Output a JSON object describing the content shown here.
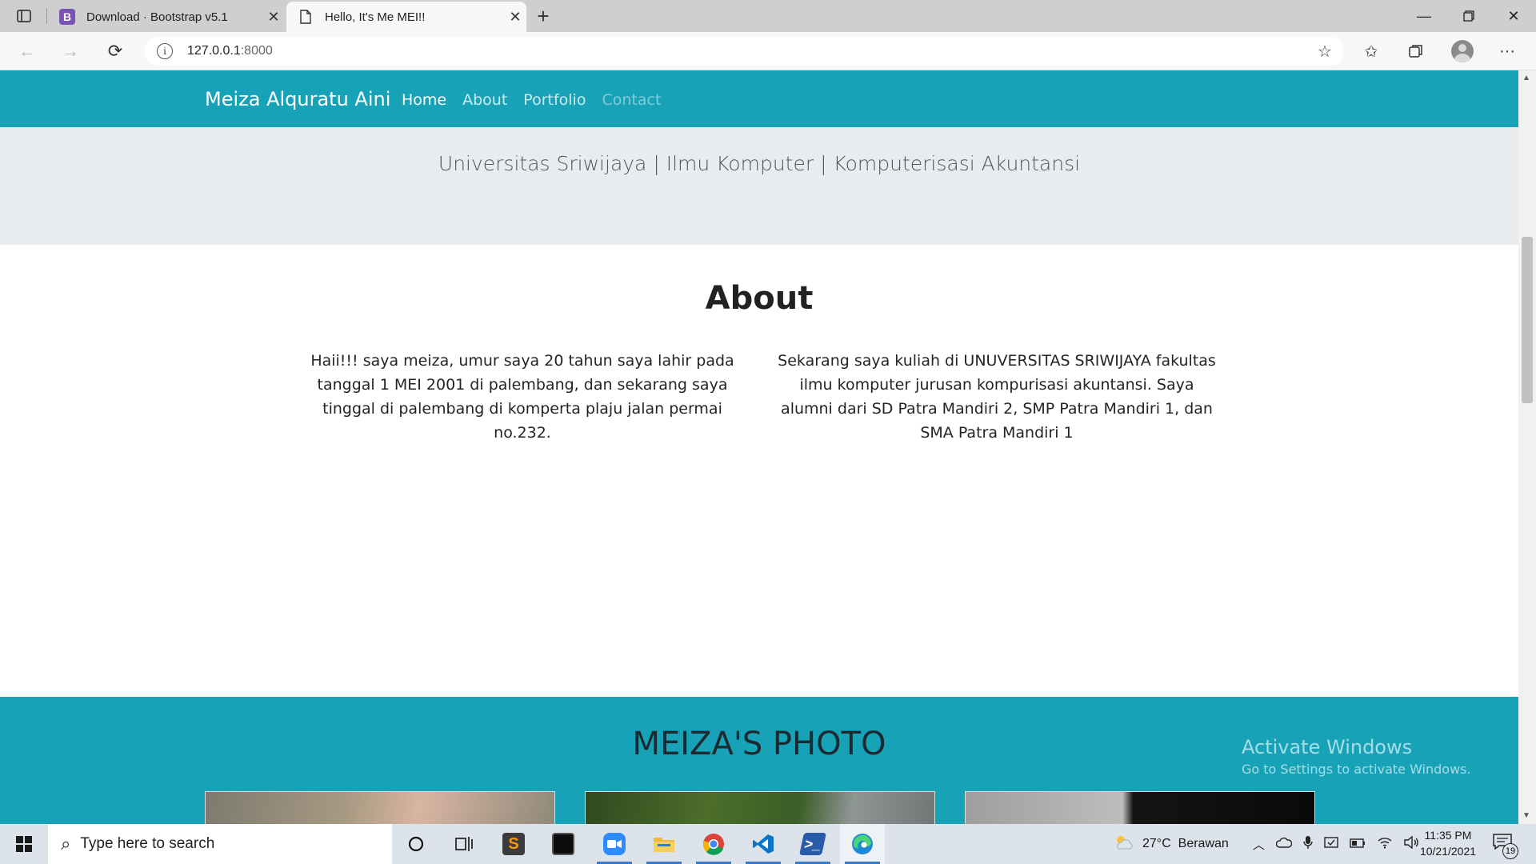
{
  "browser": {
    "tabs": [
      {
        "title": "Download · Bootstrap v5.1",
        "favicon": "bootstrap-icon",
        "active": false
      },
      {
        "title": "Hello, It's Me MEI!!",
        "favicon": "page-icon",
        "active": true
      }
    ],
    "address": {
      "host": "127.0.0.1",
      "port": ":8000"
    }
  },
  "site": {
    "brand": "Meiza Alquratu Aini",
    "nav": [
      "Home",
      "About",
      "Portfolio",
      "Contact"
    ],
    "jumbotron_lead": "Universitas Sriwijaya | Ilmu Komputer | Komputerisasi Akuntansi",
    "about": {
      "heading": "About",
      "col1": "Haii!!! saya meiza, umur saya 20 tahun saya lahir pada tanggal 1 MEI 2001 di palembang, dan sekarang saya tinggal di palembang di komperta plaju jalan permai no.232.",
      "col2": "Sekarang saya kuliah di UNUVERSITAS SRIWIJAYA fakultas ilmu komputer jurusan kompurisasi akuntansi. Saya alumni dari SD Patra Mandiri 2, SMP Patra Mandiri 1, dan SMA Patra Mandiri 1"
    },
    "photos": {
      "heading": "MEIZA'S PHOTO"
    },
    "accent_color": "#17a2b8"
  },
  "watermark": {
    "line1": "Activate Windows",
    "line2": "Go to Settings to activate Windows."
  },
  "taskbar": {
    "search_placeholder": "Type here to search",
    "weather": "27°C  Berawan",
    "time": "11:35 PM",
    "date": "10/21/2021",
    "notification_count": "19"
  }
}
